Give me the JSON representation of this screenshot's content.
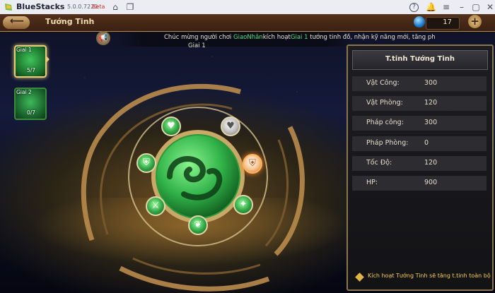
{
  "app": {
    "name": "BlueStacks",
    "version": "5.0.0.7220",
    "channel": "Beta",
    "titlebar_icons": [
      "home-icon",
      "multi-instance-icon",
      "help-icon",
      "notification-icon",
      "menu-icon",
      "minimize-icon",
      "maximize-icon",
      "close-icon"
    ]
  },
  "game": {
    "header": {
      "title": "Tướng Tinh",
      "currency_value": "17",
      "add_label": "+"
    },
    "notice": {
      "text_prefix": "Chúc mừng người chơi ",
      "player": "GiaoNhân",
      "text_middle": "kích hoạt",
      "tier": "Giai 1",
      "text_suffix": " tướng tinh đồ, nhận kỹ năng mới,  tăng ph",
      "line2": "Giai 1"
    },
    "tiers": [
      {
        "label": "Giai 1",
        "progress": "5/7",
        "selected": true
      },
      {
        "label": "Giai 2",
        "progress": "0/7",
        "selected": false
      }
    ],
    "panel": {
      "title": "T.tinh Tướng Tinh",
      "stats": [
        {
          "label": "Vật Công:",
          "value": "300"
        },
        {
          "label": "Vật Phòng:",
          "value": "120"
        },
        {
          "label": "Pháp công:",
          "value": "300"
        },
        {
          "label": "Pháp Phòng:",
          "value": "0"
        },
        {
          "label": "Tốc Độ:",
          "value": "120"
        },
        {
          "label": "HP:",
          "value": "900"
        }
      ],
      "note": "Kích hoạt Tướng Tinh sẽ tăng t.tinh toàn bộ"
    },
    "colors": {
      "accent_gold": "#e7cf7a",
      "highlight_green": "#4ee07a",
      "note_yellow": "#f2cf56"
    }
  }
}
